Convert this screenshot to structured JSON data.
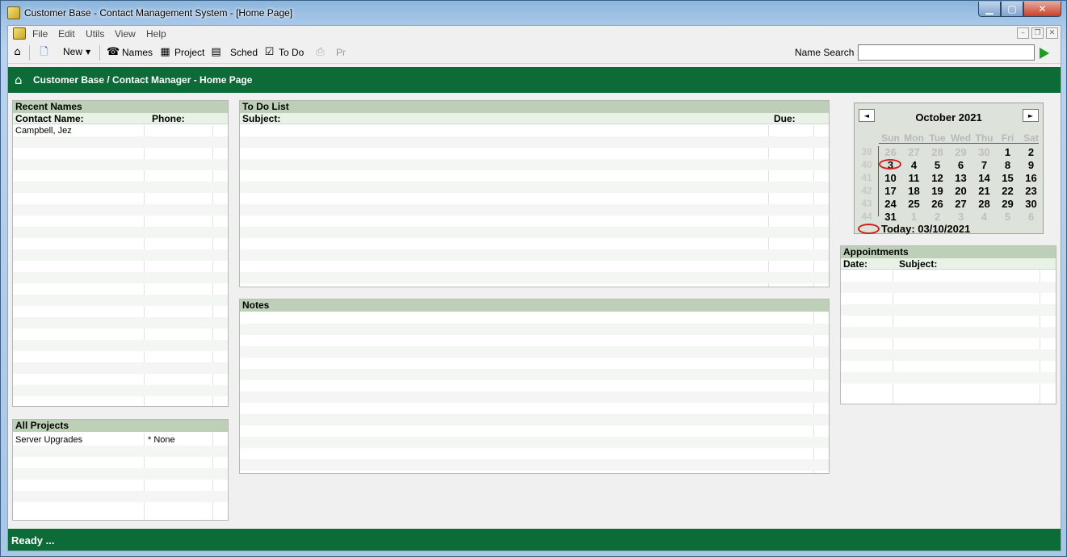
{
  "window": {
    "title": "Customer Base - Contact Management System - [Home Page]",
    "controls": [
      "minimize",
      "maximize",
      "close"
    ]
  },
  "menu": {
    "items": [
      "File",
      "Edit",
      "Utils",
      "View",
      "Help"
    ]
  },
  "toolbar": {
    "new_label": "New",
    "names_label": "Names",
    "project_label": "Project",
    "sched_label": "Sched",
    "todo_label": "To Do",
    "print_label": "Pr",
    "name_search_label": "Name Search :",
    "name_search_value": ""
  },
  "header": {
    "title": "Customer Base / Contact Manager - Home Page"
  },
  "recent_names": {
    "title": "Recent Names",
    "col_contact": "Contact Name:",
    "col_phone": "Phone:",
    "rows": [
      {
        "contact": "Campbell, Jez",
        "phone": ""
      }
    ]
  },
  "all_projects": {
    "title": "All Projects",
    "rows": [
      {
        "name": "Server Upgrades",
        "status": "* None"
      }
    ]
  },
  "todo_list": {
    "title": "To Do List",
    "col_subject": "Subject:",
    "col_due": "Due:"
  },
  "notes": {
    "title": "Notes"
  },
  "calendar": {
    "month_label": "October 2021",
    "prev_icon": "◄",
    "next_icon": "►",
    "weekdays": [
      "Sun",
      "Mon",
      "Tue",
      "Wed",
      "Thu",
      "Fri",
      "Sat"
    ],
    "weeks": [
      {
        "num": "39",
        "days": [
          {
            "d": "26",
            "other": true
          },
          {
            "d": "27",
            "other": true
          },
          {
            "d": "28",
            "other": true
          },
          {
            "d": "29",
            "other": true
          },
          {
            "d": "30",
            "other": true
          },
          {
            "d": "1"
          },
          {
            "d": "2"
          }
        ]
      },
      {
        "num": "40",
        "days": [
          {
            "d": "3",
            "selected": true
          },
          {
            "d": "4"
          },
          {
            "d": "5"
          },
          {
            "d": "6"
          },
          {
            "d": "7"
          },
          {
            "d": "8"
          },
          {
            "d": "9"
          }
        ]
      },
      {
        "num": "41",
        "days": [
          {
            "d": "10"
          },
          {
            "d": "11"
          },
          {
            "d": "12"
          },
          {
            "d": "13"
          },
          {
            "d": "14"
          },
          {
            "d": "15"
          },
          {
            "d": "16"
          }
        ]
      },
      {
        "num": "42",
        "days": [
          {
            "d": "17"
          },
          {
            "d": "18"
          },
          {
            "d": "19"
          },
          {
            "d": "20"
          },
          {
            "d": "21"
          },
          {
            "d": "22"
          },
          {
            "d": "23"
          }
        ]
      },
      {
        "num": "43",
        "days": [
          {
            "d": "24"
          },
          {
            "d": "25"
          },
          {
            "d": "26"
          },
          {
            "d": "27"
          },
          {
            "d": "28"
          },
          {
            "d": "29"
          },
          {
            "d": "30"
          }
        ]
      },
      {
        "num": "44",
        "days": [
          {
            "d": "31"
          },
          {
            "d": "1",
            "other": true
          },
          {
            "d": "2",
            "other": true
          },
          {
            "d": "3",
            "other": true
          },
          {
            "d": "4",
            "other": true
          },
          {
            "d": "5",
            "other": true
          },
          {
            "d": "6",
            "other": true
          }
        ]
      }
    ],
    "today_label": "Today: 03/10/2021"
  },
  "appointments": {
    "title": "Appointments",
    "col_date": "Date:",
    "col_subject": "Subject:"
  },
  "status": {
    "text": "Ready ..."
  }
}
